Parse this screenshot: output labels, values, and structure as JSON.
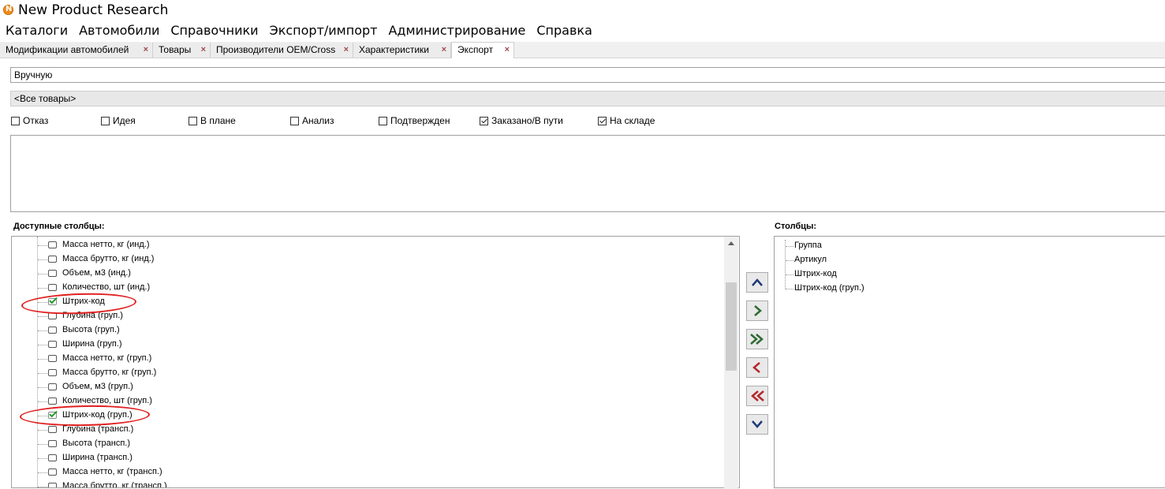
{
  "window": {
    "title": "New Product Research"
  },
  "menu": [
    "Каталоги",
    "Автомобили",
    "Справочники",
    "Экспорт/импорт",
    "Администрирование",
    "Справка"
  ],
  "tabs": [
    {
      "label": "Модификации автомобилей",
      "close": "×"
    },
    {
      "label": "Товары",
      "close": "×"
    },
    {
      "label": "Производители OEM/Cross",
      "close": "×"
    },
    {
      "label": "Характеристики",
      "close": "×"
    },
    {
      "label": "Экспорт",
      "close": "×",
      "active": true
    }
  ],
  "mode_field": {
    "value": "Вручную"
  },
  "filter": {
    "value": "<Все товары>"
  },
  "statuses": [
    {
      "label": "Отказ",
      "checked": false
    },
    {
      "label": "Идея",
      "checked": false
    },
    {
      "label": "В плане",
      "checked": false
    },
    {
      "label": "Анализ",
      "checked": false
    },
    {
      "label": "Подтвержден",
      "checked": false
    },
    {
      "label": "Заказано/В пути",
      "checked": true
    },
    {
      "label": "На складе",
      "checked": true
    }
  ],
  "available_columns": {
    "header": "Доступные столбцы:",
    "items": [
      {
        "label": "Масса нетто, кг (инд.)",
        "checked": false
      },
      {
        "label": "Масса брутто, кг (инд.)",
        "checked": false
      },
      {
        "label": "Объем, м3 (инд.)",
        "checked": false
      },
      {
        "label": "Количество, шт (инд.)",
        "checked": false
      },
      {
        "label": "Штрих-код",
        "checked": true
      },
      {
        "label": "Глубина (груп.)",
        "checked": false
      },
      {
        "label": "Высота (груп.)",
        "checked": false
      },
      {
        "label": "Ширина (груп.)",
        "checked": false
      },
      {
        "label": "Масса нетто, кг (груп.)",
        "checked": false
      },
      {
        "label": "Масса брутто, кг (груп.)",
        "checked": false
      },
      {
        "label": "Объем, м3 (груп.)",
        "checked": false
      },
      {
        "label": "Количество, шт (груп.)",
        "checked": false
      },
      {
        "label": "Штрих-код (груп.)",
        "checked": true
      },
      {
        "label": "Глубина (трансп.)",
        "checked": false
      },
      {
        "label": "Высота (трансп.)",
        "checked": false
      },
      {
        "label": "Ширина (трансп.)",
        "checked": false
      },
      {
        "label": "Масса нетто, кг (трансп.)",
        "checked": false
      },
      {
        "label": "Масса брутто, кг (трансп.)",
        "checked": false
      }
    ]
  },
  "selected_columns": {
    "header": "Столбцы:",
    "items": [
      "Группа",
      "Артикул",
      "Штрих-код",
      "Штрих-код (груп.)"
    ]
  },
  "move_buttons": [
    {
      "name": "move-up-button",
      "icon": "chevron-up-icon",
      "color": "#1f3a7a"
    },
    {
      "name": "add-column-button",
      "icon": "chevron-right-icon",
      "color": "#2f6b33"
    },
    {
      "name": "add-all-columns-button",
      "icon": "double-chevron-right-icon",
      "color": "#2f6b33"
    },
    {
      "name": "remove-column-button",
      "icon": "chevron-left-icon",
      "color": "#b3282d"
    },
    {
      "name": "remove-all-columns-button",
      "icon": "double-chevron-left-icon",
      "color": "#b3282d"
    },
    {
      "name": "move-down-button",
      "icon": "chevron-down-icon",
      "color": "#1f3a7a"
    }
  ],
  "colors": {
    "annotation": "#e02020",
    "checkmark": "#1e9a30"
  }
}
